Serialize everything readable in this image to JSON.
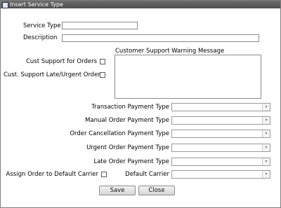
{
  "window": {
    "title": "Insert Service Type"
  },
  "form": {
    "service_type_label": "Service Type",
    "description_label": "Description",
    "cust_support_orders_label": "Cust Support for Orders",
    "cust_support_late_label": "Cust. Support Late/Urgent Orders",
    "warning_message_label": "Customer Support Warning Message",
    "transaction_payment_label": "Transaction Payment Type",
    "manual_order_payment_label": "Manual Order Payment Type",
    "order_cancellation_payment_label": "Order Cancellation Payment Type",
    "urgent_order_payment_label": "Urgent Order Payment Type",
    "late_order_payment_label": "Late Order Payment Type",
    "assign_default_carrier_label": "Assign Order to Default Carrier",
    "default_carrier_label": "Default Carrier"
  },
  "buttons": {
    "save": "Save",
    "close": "Close"
  },
  "icons": {
    "dropdown": "▾"
  }
}
